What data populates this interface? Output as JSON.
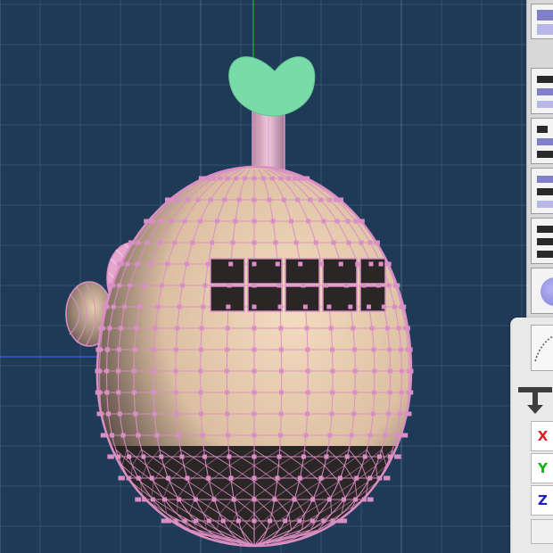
{
  "viewport": {
    "background_color": "#1f3a57",
    "grid_color": "#6f8da8",
    "y_axis_color": "#2fb02f",
    "x_axis_color": "#3a5cff",
    "wireframe_color": "#d98fc4",
    "model_body_color": "#e9cdb0",
    "model_leaf_color": "#79dba8",
    "model_band_color": "#2b2626"
  },
  "toolbar": {
    "buttons": [
      {
        "icon": "layout-split-icon"
      },
      {
        "icon": "layout-top-icon"
      },
      {
        "icon": "layout-bars-icon"
      },
      {
        "icon": "layout-columns-icon"
      },
      {
        "icon": "layout-list-icon"
      },
      {
        "icon": "sphere-icon"
      }
    ]
  },
  "axis_panel": {
    "curve_icon": "curve-tool-icon",
    "move_icon": "move-tool-icon",
    "x_label": "X",
    "y_label": "Y",
    "z_label": "Z",
    "x_color": "#e02020",
    "y_color": "#18b018",
    "z_color": "#2020c0"
  }
}
